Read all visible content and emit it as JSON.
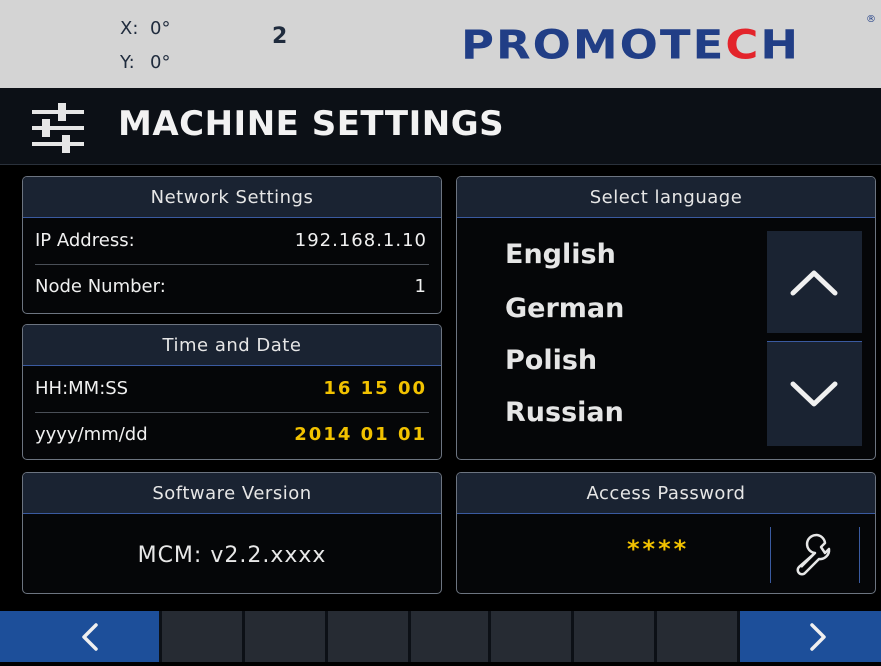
{
  "status": {
    "x_label": "X:",
    "x_value": "0°",
    "y_label": "Y:",
    "y_value": "0°",
    "counter": "2",
    "logo_text_a": "PROMOTE",
    "logo_text_b": "C",
    "logo_text_c": "H",
    "logo_mark": "®"
  },
  "header": {
    "title": "MACHINE SETTINGS",
    "icon": "sliders-icon"
  },
  "network": {
    "title": "Network Settings",
    "ip_label": "IP Address:",
    "ip_value": "192.168.1.10",
    "node_label": "Node Number:",
    "node_value": "1"
  },
  "time": {
    "title": "Time and Date",
    "time_label": "HH:MM:SS",
    "time_value": "16 15 00",
    "date_label": "yyyy/mm/dd",
    "date_value": "2014 01 01"
  },
  "software": {
    "title": "Software Version",
    "value": "MCM: v2.2.xxxx"
  },
  "language": {
    "title": "Select language",
    "items": [
      "English",
      "German",
      "Polish",
      "Russian"
    ],
    "up_icon": "chevron-up-icon",
    "down_icon": "chevron-down-icon"
  },
  "password": {
    "title": "Access Password",
    "value": "****",
    "icon": "wrench-icon"
  },
  "bottom": {
    "prev_icon": "chevron-left-icon",
    "next_icon": "chevron-right-icon"
  },
  "colors": {
    "accent_blue": "#1d4f9a",
    "value_yellow": "#f2c200",
    "logo_red": "#e3242b",
    "logo_blue": "#213e86"
  }
}
